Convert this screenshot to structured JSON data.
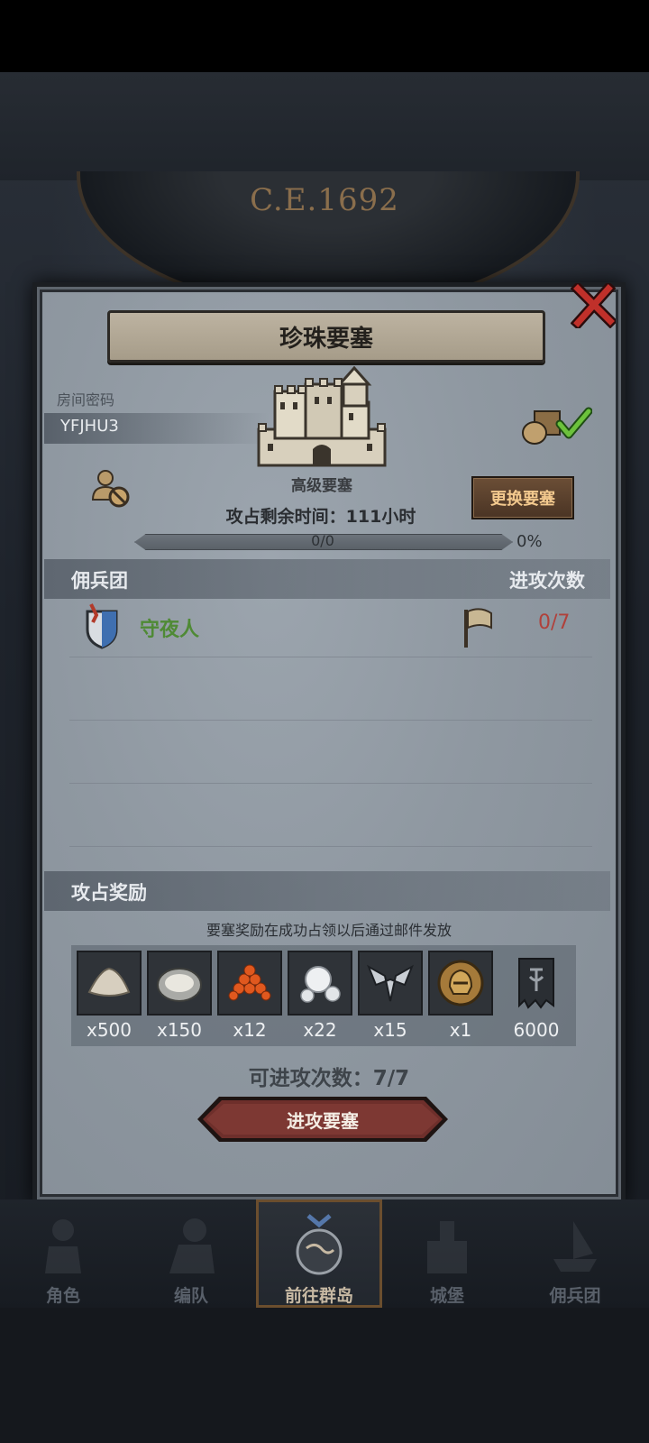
{
  "header": {
    "year": "C.E.1692"
  },
  "dialog": {
    "title": "珍珠要塞",
    "room_label": "房间密码",
    "room_code": "YFJHU3",
    "fortress_level": "高级要塞",
    "change_button": "更换要塞",
    "remaining_time": "攻占剩余时间：111小时",
    "progress": {
      "text": "0/0",
      "percent_label": "0%",
      "fraction": 0
    },
    "mercenary_section": {
      "left_label": "佣兵团",
      "right_label": "进攻次数"
    },
    "mercenaries": [
      {
        "name": "守夜人",
        "attacks": "0/7"
      }
    ],
    "reward_section": {
      "label": "攻占奖励",
      "notice": "要塞奖励在成功占领以后通过邮件发放",
      "items": [
        {
          "icon": "sand-icon",
          "count": "x500"
        },
        {
          "icon": "oyster-icon",
          "count": "x150"
        },
        {
          "icon": "roe-icon",
          "count": "x12"
        },
        {
          "icon": "pearl-icon",
          "count": "x22"
        },
        {
          "icon": "emblem-icon",
          "count": "x15"
        },
        {
          "icon": "helmet-coin-icon",
          "count": "x1"
        },
        {
          "icon": "banner-icon",
          "count": "6000"
        }
      ]
    },
    "available_attacks": "可进攻次数：7/7",
    "attack_button": "进攻要塞"
  },
  "nav": {
    "items": [
      {
        "label": "角色",
        "icon": "knight-icon"
      },
      {
        "label": "编队",
        "icon": "squad-icon"
      },
      {
        "label": "前往群岛",
        "icon": "globe-icon"
      },
      {
        "label": "城堡",
        "icon": "castle-icon"
      },
      {
        "label": "佣兵团",
        "icon": "ship-icon"
      }
    ],
    "active_index": 2
  },
  "colors": {
    "merc_name": "#4f8a35",
    "attack_count": "#b0413b",
    "change_button_text": "#f3c98e"
  }
}
